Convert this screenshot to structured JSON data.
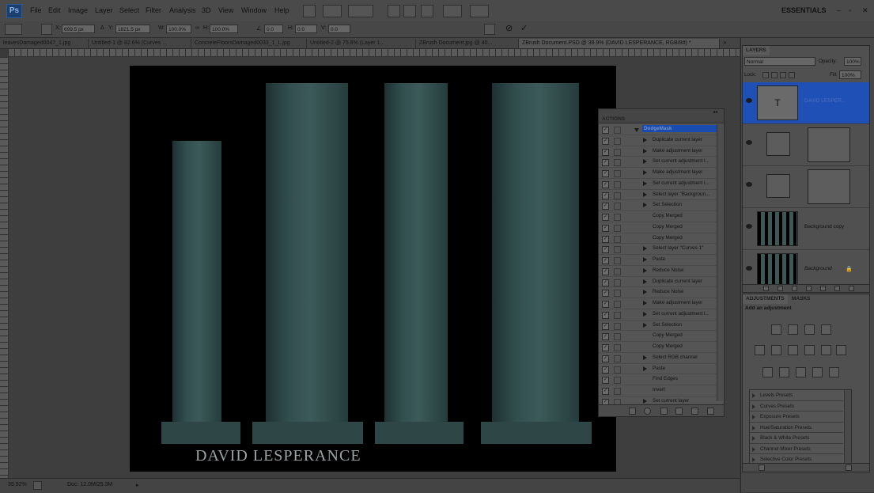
{
  "app": {
    "logo": "Ps"
  },
  "menu": [
    "File",
    "Edit",
    "Image",
    "Layer",
    "Select",
    "Filter",
    "Analysis",
    "3D",
    "View",
    "Window",
    "Help"
  ],
  "workspace_label": "ESSENTIALS",
  "options": {
    "x_label": "X:",
    "x_value": "699.5 px",
    "y_label": "Y:",
    "y_value": "1821.5 px",
    "w_label": "W:",
    "w_value": "100.0%",
    "h_label": "H:",
    "h_value": "100.0%",
    "angle_value": "0.0",
    "hskew_label": "H:",
    "hskew_value": "0.0",
    "vskew_label": "V:",
    "vskew_value": "0.0"
  },
  "tabs": [
    "leavesDamaged0047_1.jpg",
    "Untitled-1 @ 82.6% (Curves ...",
    "ConcreteFloorsDamaged0033_1_L.jpg",
    "Untitled-2 @ 75.8% (Layer 1...",
    "ZBrush Document.jpg @ 40...",
    "ZBrush Document.PSD @ 39.9% (DAVID LESPERANCE, RGB/8#) *"
  ],
  "canvas": {
    "caption": "DAVID LESPERANCE"
  },
  "status": {
    "zoom": "39.92%",
    "doc": "Doc: 12.0M/25.3M"
  },
  "actions_panel": {
    "title": "ACTIONS",
    "items": [
      {
        "label": "DodgeMask",
        "group": true
      },
      {
        "label": "Duplicate current layer",
        "arrow": true
      },
      {
        "label": "Make adjustment layer",
        "arrow": true
      },
      {
        "label": "Set current adjustment l...",
        "arrow": true
      },
      {
        "label": "Make adjustment layer",
        "arrow": true
      },
      {
        "label": "Set current adjustment l...",
        "arrow": true
      },
      {
        "label": "Select layer \"Backgroun...",
        "arrow": true
      },
      {
        "label": "Set Selection",
        "arrow": true
      },
      {
        "label": "Copy Merged",
        "arrow": false
      },
      {
        "label": "Copy Merged",
        "arrow": false
      },
      {
        "label": "Copy Merged",
        "arrow": false
      },
      {
        "label": "Select layer \"Curves 1\"",
        "arrow": true
      },
      {
        "label": "Paste",
        "arrow": true
      },
      {
        "label": "Reduce Noise",
        "arrow": true
      },
      {
        "label": "Duplicate current layer",
        "arrow": true
      },
      {
        "label": "Reduce Noise",
        "arrow": true
      },
      {
        "label": "Make adjustment layer",
        "arrow": true
      },
      {
        "label": "Set current adjustment l...",
        "arrow": true
      },
      {
        "label": "Set Selection",
        "arrow": true
      },
      {
        "label": "Copy Merged",
        "arrow": false
      },
      {
        "label": "Copy Merged",
        "arrow": false
      },
      {
        "label": "Select RGB channel",
        "arrow": true
      },
      {
        "label": "Paste",
        "arrow": true
      },
      {
        "label": "Find Edges",
        "arrow": false
      },
      {
        "label": "Invert",
        "arrow": false
      },
      {
        "label": "Set current layer",
        "arrow": true
      }
    ]
  },
  "layers_panel": {
    "title": "LAYERS",
    "blend_mode": "Normal",
    "opacity_label": "Opacity:",
    "opacity_value": "100%",
    "lock_label": "Lock:",
    "fill_label": "Fill:",
    "fill_value": "100%",
    "layers": [
      {
        "name": "DAVID LESPER...",
        "type": "text",
        "selected": true
      },
      {
        "name": "",
        "type": "adjustment"
      },
      {
        "name": "",
        "type": "adjustment"
      },
      {
        "name": "Background copy",
        "type": "image"
      },
      {
        "name": "Background",
        "type": "image",
        "locked": true
      }
    ]
  },
  "adjustments_panel": {
    "tab1": "ADJUSTMENTS",
    "tab2": "MASKS",
    "heading": "Add an adjustment",
    "presets": [
      "Levels Presets",
      "Curves Presets",
      "Exposure Presets",
      "Hue/Saturation Presets",
      "Black & White Presets",
      "Channel Mixer Presets",
      "Selective Color Presets"
    ]
  }
}
